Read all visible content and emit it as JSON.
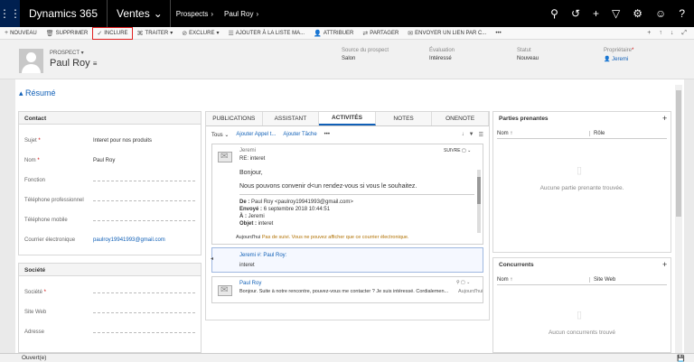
{
  "topbar": {
    "app": "Dynamics 365",
    "area": "Ventes",
    "crumbs": [
      "Prospects",
      "Paul Roy"
    ]
  },
  "commands": [
    "NOUVEAU",
    "SUPPRIMER",
    "INCLURE",
    "TRAITER",
    "EXCLURE",
    "AJOUTER À LA LISTE MA...",
    "ATTRIBUER",
    "PARTAGER",
    "ENVOYER UN LIEN PAR C...",
    "•••"
  ],
  "header": {
    "entity_type": "PROSPECT",
    "name": "Paul Roy",
    "fields": [
      {
        "label": "Source du prospect",
        "value": "Salon"
      },
      {
        "label": "Évaluation",
        "value": "Intéressé"
      },
      {
        "label": "Statut",
        "value": "Nouveau"
      },
      {
        "label": "Propriétaire",
        "value": "Jeremi"
      }
    ]
  },
  "section_title": "Résumé",
  "contact": {
    "title": "Contact",
    "rows": [
      {
        "label": "Sujet",
        "value": "Interet pour nos produits"
      },
      {
        "label": "Nom",
        "value": "Paul Roy"
      },
      {
        "label": "Fonction",
        "value": ""
      },
      {
        "label": "Téléphone professionnel",
        "value": ""
      },
      {
        "label": "Téléphone mobile",
        "value": ""
      },
      {
        "label": "Courrier électronique",
        "value": "paulroy19941993@gmail.com"
      }
    ]
  },
  "company": {
    "title": "Société",
    "rows": [
      {
        "label": "Société",
        "value": ""
      },
      {
        "label": "Site Web",
        "value": ""
      },
      {
        "label": "Adresse",
        "value": ""
      }
    ]
  },
  "timeline": {
    "tabs": [
      "PUBLICATIONS",
      "ASSISTANT",
      "ACTIVITÉS",
      "NOTES",
      "ONENOTE"
    ],
    "filter": "Tous",
    "add_call": "Ajouter Appel t...",
    "add_task": "Ajouter Tâche",
    "more": "•••",
    "email1": {
      "from": "Jeremi",
      "subject": "RE: interet",
      "follow": "SUIVRE",
      "greeting": "Bonjour,",
      "body": "Nous pouvons convenir d<un rendez-vous si vous le souhaitez.",
      "de_label": "De :",
      "de": "Paul Roy <paulroy19941993@gmail.com>",
      "envoye_label": "Envoyé :",
      "envoye": "6 septembre 2018 10:44:51",
      "a_label": "À :",
      "a": "Jeremi",
      "objet_label": "Objet :",
      "objet": "interet",
      "date": "Aujourd'hui",
      "note": "Pas de suivi. Vous ne pouvez afficher que ce courrier électronique."
    },
    "post": {
      "title": "Jeremi #: Paul Roy:",
      "text": "interet"
    },
    "email2": {
      "from": "Paul Roy",
      "text": "Bonjour. Suite à notre rencontre, pouvez-vous me contacter ? Je suis intéressé. Cordialemen...",
      "date": "Aujourd'hui"
    }
  },
  "stakeholders": {
    "title": "Parties prenantes",
    "col1": "Nom ↑",
    "col2": "Rôle",
    "empty": "Aucune partie prenante trouvée."
  },
  "competitors": {
    "title": "Concurrents",
    "col1": "Nom ↑",
    "col2": "Site Web",
    "empty": "Aucun concurrents trouvé"
  },
  "status": "Ouvert(e)"
}
